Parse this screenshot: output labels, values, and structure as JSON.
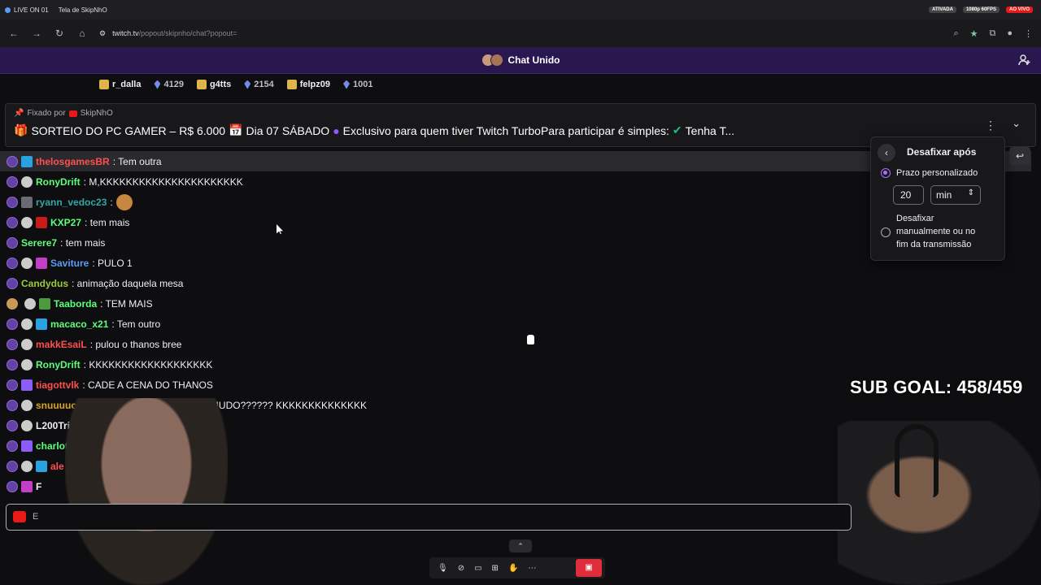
{
  "browser": {
    "tabs": [
      {
        "label": "LIVE ON 01"
      },
      {
        "label": "Tela de SkipNhO"
      }
    ],
    "status": {
      "activated": "ATIVADA",
      "quality": "1080p 60FPS",
      "live": "AO VIVO"
    },
    "url": {
      "host": "twitch.tv",
      "path": "/popout/skipnho/chat?popout="
    }
  },
  "header": {
    "title": "Chat Unido"
  },
  "leaderboard": [
    {
      "name": "r_dalla",
      "icon": "gift-icon"
    },
    {
      "count": "4129",
      "icon": "bits-icon"
    },
    {
      "name": "g4tts",
      "icon": "gift-icon"
    },
    {
      "count": "2154",
      "icon": "bits-icon"
    },
    {
      "name": "felpz09",
      "icon": "gift-icon"
    },
    {
      "count": "1001",
      "icon": "bits-icon"
    }
  ],
  "pinned": {
    "pinned_by_prefix": "Fixado por",
    "pinned_by": "SkipNhO",
    "parts": [
      "SORTEIO DO PC GAMER – R$ 6.000",
      "Dia 07 SÁBADO",
      "Exclusivo para quem tiver Twitch TurboPara participar é simples:",
      "Tenha T..."
    ]
  },
  "messages": [
    {
      "user": "thelosgamesBR",
      "color": "#ff4f4f",
      "text": ": Tem outra",
      "hl": true
    },
    {
      "user": "RonyDrift",
      "color": "#5cff7a",
      "text": ": M,KKKKKKKKKKKKKKKKKKKKKK"
    },
    {
      "user": "ryann_vedoc23",
      "color": "#2ea8a8",
      "text": ":"
    },
    {
      "user": "KXP27",
      "color": "#5cff7a",
      "text": ": tem mais"
    },
    {
      "user": "Serere7",
      "color": "#5cff7a",
      "text": ": tem mais"
    },
    {
      "user": "Saviture",
      "color": "#5b9cf5",
      "text": ": PULO 1"
    },
    {
      "user": "Candydus",
      "color": "#9acd32",
      "text": ": animação daquela mesa"
    },
    {
      "user": "Taaborda",
      "color": "#5cff7a",
      "text": ": TEM MAIS"
    },
    {
      "user": "macaco_x21",
      "color": "#5cff7a",
      "text": ": Tem outro"
    },
    {
      "user": "makkEsaiL",
      "color": "#ff4f4f",
      "text": ": pulou o thanos bree"
    },
    {
      "user": "RonyDrift",
      "color": "#5cff7a",
      "text": ": KKKKKKKKKKKKKKKKKKK"
    },
    {
      "user": "tiagottvlk",
      "color": "#ff4f4f",
      "text": ": CADE A CENA DO THANOS"
    },
    {
      "user": "snuuuuck",
      "color": "#daa520",
      "text": ": TA ASSI...DO O FILME NO MUDO?????? KKKKKKKKKKKKKK"
    },
    {
      "user": "L200Trito",
      "color": "#efeff1",
      "text": ""
    },
    {
      "user": "charlott",
      "color": "#5cff7a",
      "text": ""
    },
    {
      "user": "ale",
      "color": "#ff4f4f",
      "text": ""
    },
    {
      "user": "F",
      "color": "#efeff1",
      "text": ""
    }
  ],
  "popup": {
    "title": "Desafixar após",
    "option1": "Prazo personalizado",
    "value": "20",
    "unit": "min",
    "option2_l1": "Desafixar",
    "option2_l2": "manualmente ou no",
    "option2_l3": "fim da transmissão"
  },
  "subgoal": "SUB GOAL: 458/459",
  "input": {
    "placeholder": "E"
  }
}
